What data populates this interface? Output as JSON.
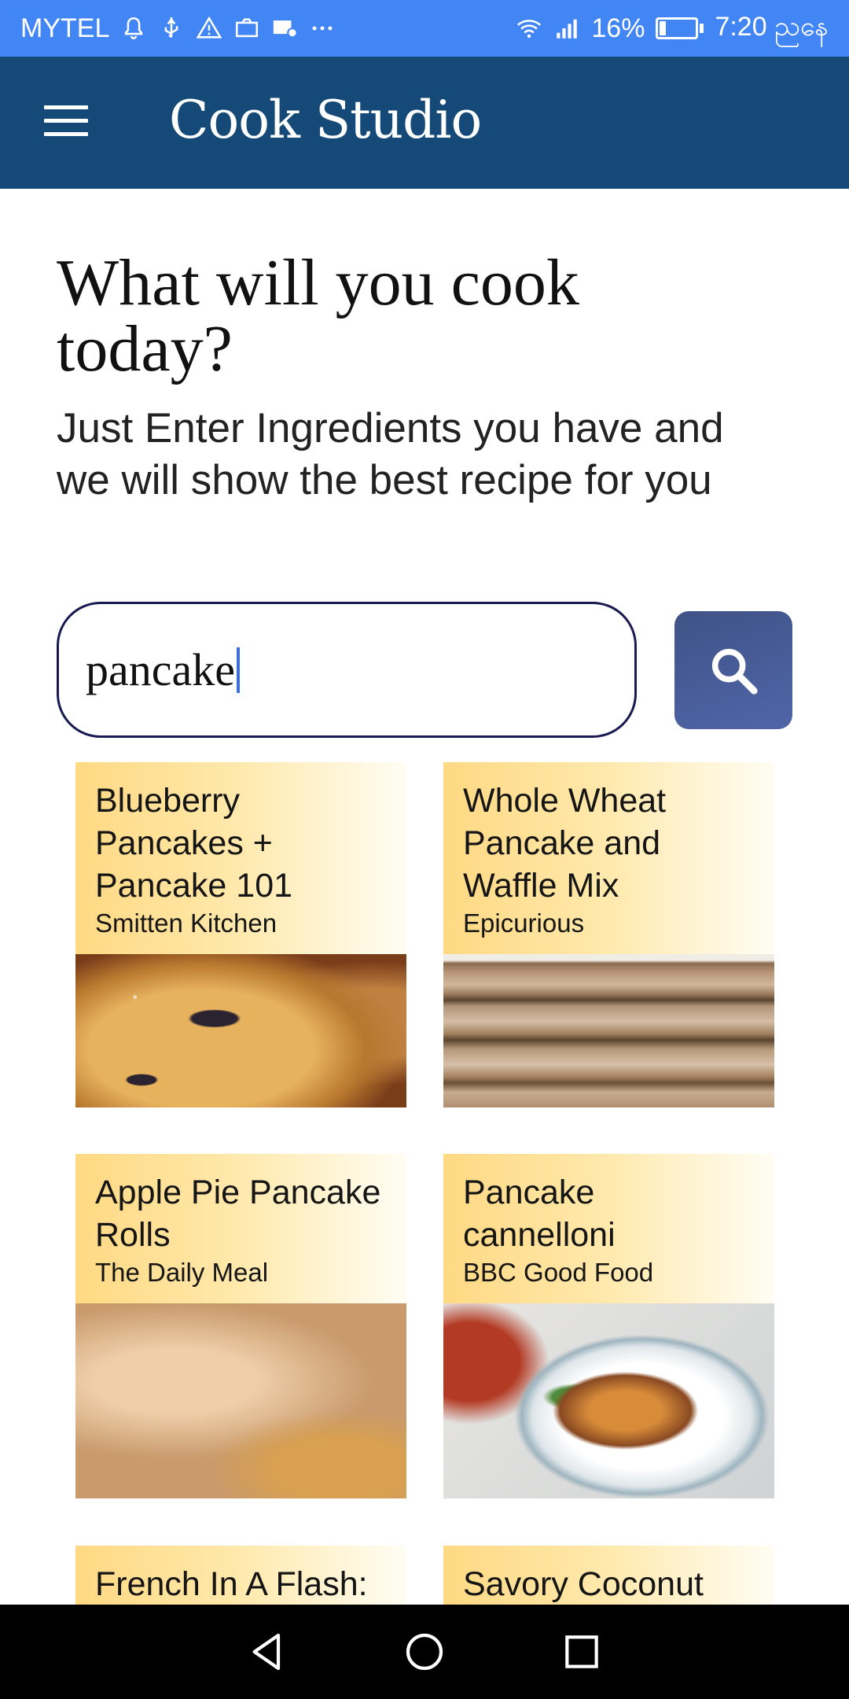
{
  "status_bar": {
    "carrier": "MYTEL",
    "battery": "16%",
    "battery_level": 0.16,
    "time": "7:20 ညနေ",
    "left_icons": [
      "notification-icon",
      "usb-icon",
      "warning-icon",
      "screenshot-icon",
      "cast-icon",
      "more-icon"
    ],
    "right_icons": [
      "wifi-icon",
      "signal-icon",
      "battery-icon"
    ]
  },
  "app_bar": {
    "title": "Cook Studio"
  },
  "hero": {
    "title_line1": "What will you cook",
    "title_line2": "today?",
    "subtitle_line1": "Just Enter Ingredients you have and",
    "subtitle_line2": "we will show the best recipe for you"
  },
  "search": {
    "value": "pancake"
  },
  "recipes": [
    {
      "title": "Blueberry Pancakes + Pancake 101",
      "source": "Smitten Kitchen",
      "image": "blueberry-pancake-photo"
    },
    {
      "title": "Whole Wheat Pancake and Waffle Mix",
      "source": "Epicurious",
      "image": "pancake-stack-photo"
    },
    {
      "title": "Apple Pie Pancake Rolls",
      "source": "The Daily Meal",
      "image": "crepe-rolls-photo"
    },
    {
      "title": "Pancake cannelloni",
      "source": "BBC Good Food",
      "image": "cannelloni-plate-photo"
    },
    {
      "title": "French In A Flash:",
      "source": "",
      "image": ""
    },
    {
      "title": "Savory Coconut",
      "source": "",
      "image": ""
    }
  ],
  "colors": {
    "status_bar": "#4285f4",
    "app_bar": "#154a78",
    "search_button": "#4a5d9c",
    "card_header_start": "#ffd983",
    "nav_bar": "#000000"
  }
}
